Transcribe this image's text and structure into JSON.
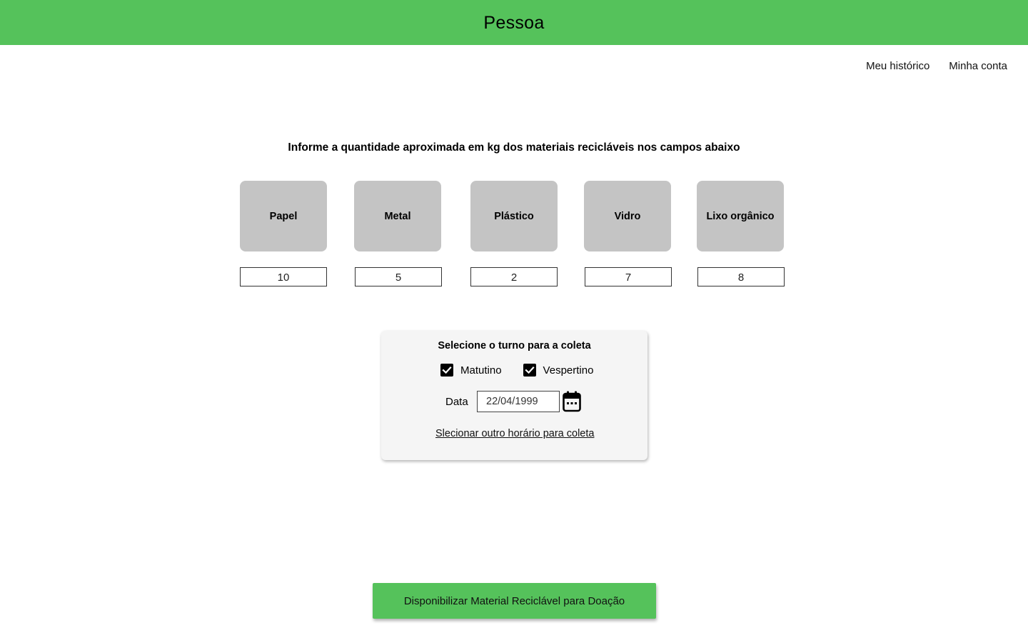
{
  "header": {
    "title": "Pessoa",
    "color": "#55c25b"
  },
  "nav": {
    "history": "Meu histórico",
    "account": "Minha conta"
  },
  "instruction": "Informe a quantidade aproximada em kg dos materiais recicláveis nos campos abaixo",
  "materials": [
    {
      "label": "Papel",
      "value": "10"
    },
    {
      "label": "Metal",
      "value": "5"
    },
    {
      "label": "Plástico",
      "value": "2"
    },
    {
      "label": "Vidro",
      "value": "7"
    },
    {
      "label": "Lixo orgânico",
      "value": "8"
    }
  ],
  "shift": {
    "title": "Selecione o turno para a coleta",
    "options": [
      {
        "label": "Matutino",
        "checked": true
      },
      {
        "label": "Vespertino",
        "checked": true
      }
    ],
    "date_label": "Data",
    "date_value": "22/04/1999",
    "other_time_link": "Slecionar outro horário para coleta"
  },
  "submit_label": "Disponibilizar Material Reciclável para Doação"
}
